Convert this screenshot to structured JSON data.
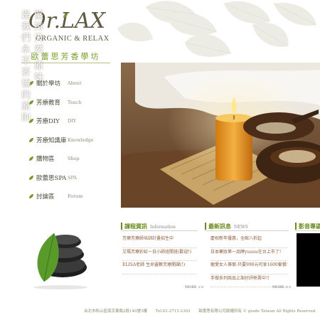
{
  "logo": {
    "main": "Or.LAX",
    "sub": "ORGANIC & RELAX"
  },
  "brand_cn": "歐蕾思芳香學坊",
  "nav": [
    {
      "zh": "關於學坊",
      "en": "About"
    },
    {
      "zh": "芳療教育",
      "en": "Teach"
    },
    {
      "zh": "芳療DIY",
      "en": "DIY"
    },
    {
      "zh": "芳療知識庫",
      "en": "Knowledge"
    },
    {
      "zh": "購物區",
      "en": "Shop"
    },
    {
      "zh": "歐蕾思SPA",
      "en": "SPA"
    },
    {
      "zh": "討論區",
      "en": "Forum"
    }
  ],
  "hero": {
    "col1": "堅持天然‧原味",
    "col2": "是我們永不妥協的原則"
  },
  "courses": {
    "title": "課程資訊",
    "title_en": "Information",
    "items": [
      "芳療芳療師培訓計畫招生中",
      "艾瑪芳療彩虹一日小師班開班(歡迎!)",
      "ELISA老師 生命靈數芳療開課(!)"
    ],
    "more": "MORE >>"
  },
  "news": {
    "title": "最新訊息",
    "title_en": "NEWS",
    "items": [
      "慶祝新年優惠，全館八折起",
      "日本藥妝第一品牌yuuuu在台上市了!",
      "寵愛女人專案-只要990元可享1600套餐!",
      "手做系列商品上架好評熱賣中!!"
    ],
    "more": "MORE >>"
  },
  "video": {
    "title": "影音專區"
  },
  "footer": {
    "address": "台北市松山區南京東路2段140號3樓",
    "tel": "Tel:02-2715-2303",
    "copyright": "歐蕾思有限公司版權所有 © grade Taiwan All Rights Reserved"
  },
  "colors": {
    "accent": "#6a8a1a",
    "text": "#5f5a43",
    "link": "#8a5a3a"
  }
}
